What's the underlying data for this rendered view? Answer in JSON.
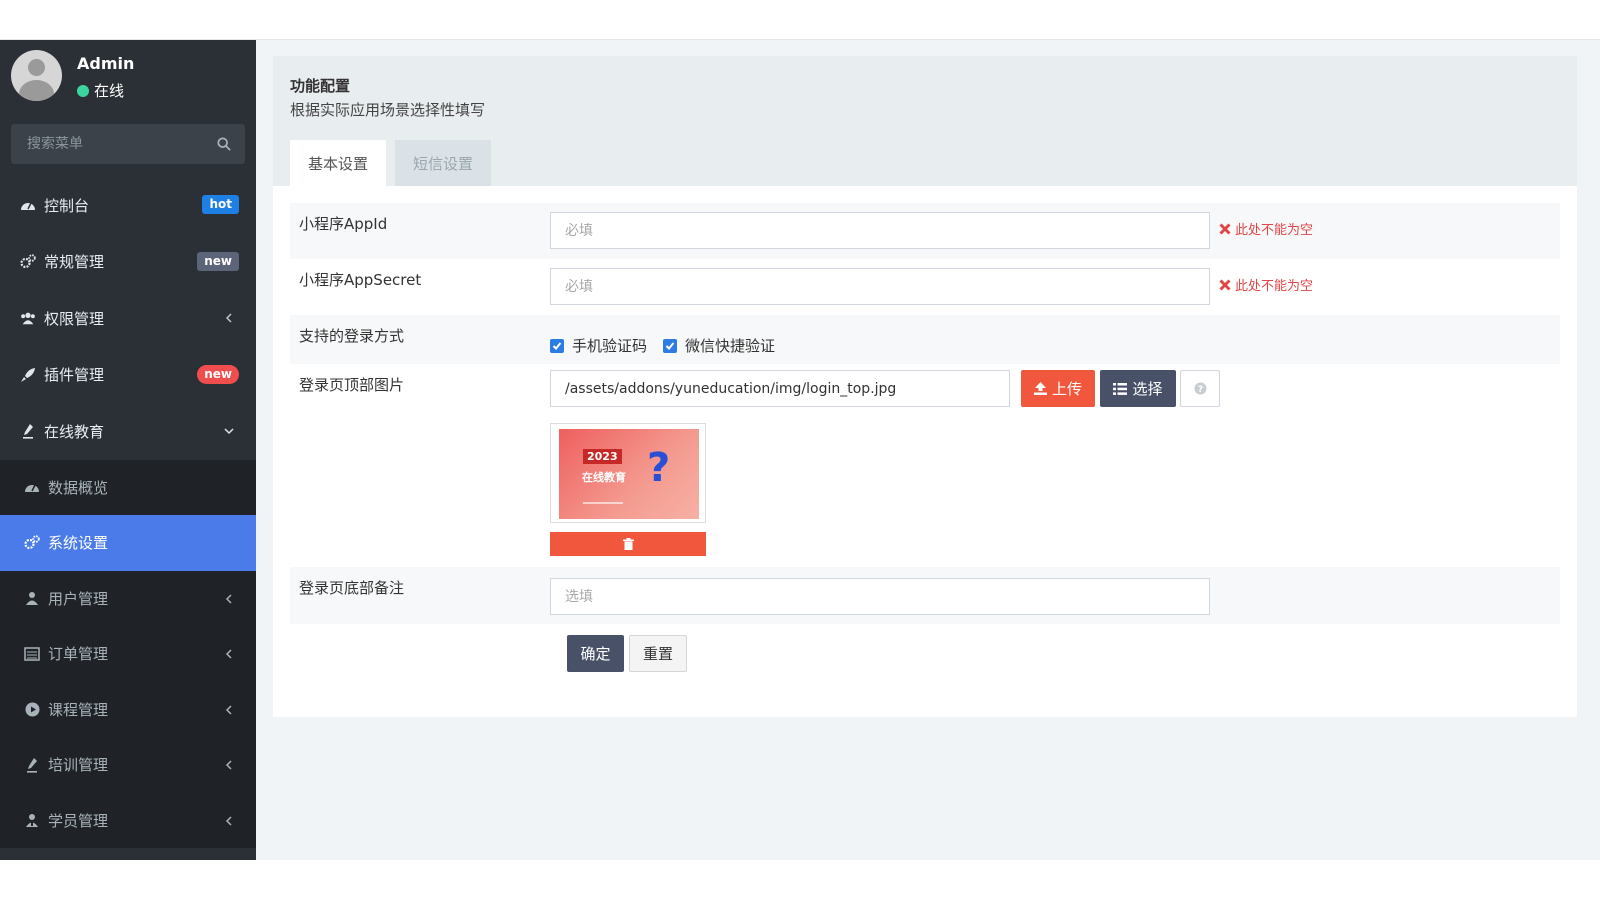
{
  "user": {
    "name": "Admin",
    "status": "在线"
  },
  "search": {
    "placeholder": "搜索菜单"
  },
  "menu": [
    {
      "label": "控制台",
      "icon": "dashboard-icon",
      "badge": "hot"
    },
    {
      "label": "常规管理",
      "icon": "gears-icon",
      "badge": "new"
    },
    {
      "label": "权限管理",
      "icon": "users-icon"
    },
    {
      "label": "插件管理",
      "icon": "rocket-icon",
      "badge": "new"
    },
    {
      "label": "在线教育",
      "icon": "pen-icon",
      "expanded": true
    }
  ],
  "submenu": [
    {
      "label": "数据概览",
      "icon": "dashboard-icon"
    },
    {
      "label": "系统设置",
      "icon": "gears-icon",
      "active": true
    },
    {
      "label": "用户管理",
      "icon": "user-icon"
    },
    {
      "label": "订单管理",
      "icon": "list-icon"
    },
    {
      "label": "课程管理",
      "icon": "play-icon"
    },
    {
      "label": "培训管理",
      "icon": "pen-icon"
    },
    {
      "label": "学员管理",
      "icon": "student-icon"
    }
  ],
  "panel": {
    "title": "功能配置",
    "subtitle": "根据实际应用场景选择性填写",
    "tabs": [
      "基本设置",
      "短信设置"
    ]
  },
  "form": {
    "appid": {
      "label": "小程序AppId",
      "placeholder": "必填",
      "error": "此处不能为空"
    },
    "appsecret": {
      "label": "小程序AppSecret",
      "placeholder": "必填",
      "error": "此处不能为空"
    },
    "login_methods": {
      "label": "支持的登录方式",
      "options": [
        "手机验证码",
        "微信快捷验证"
      ]
    },
    "top_image": {
      "label": "登录页顶部图片",
      "value": "/assets/addons/yuneducation/img/login_top.jpg",
      "upload_label": "上传",
      "choose_label": "选择",
      "preview_year": "2023",
      "preview_text": "在线教育",
      "preview_mark": "?"
    },
    "bottom_note": {
      "label": "登录页底部备注",
      "placeholder": "选填"
    },
    "submit_label": "确定",
    "reset_label": "重置"
  },
  "colors": {
    "sidebar": "#2b3036",
    "active": "#4a7be8",
    "danger": "#f1573c",
    "primary": "#485168"
  }
}
